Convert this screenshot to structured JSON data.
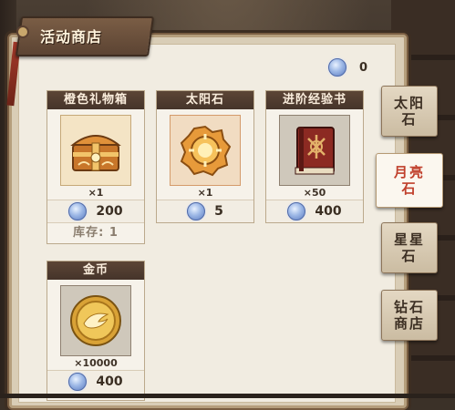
{
  "shop": {
    "title": "活动商店"
  },
  "currency": {
    "icon": "moon-stone-icon",
    "amount": "0"
  },
  "items": [
    {
      "name": "橙色礼物箱",
      "icon": "orange-gift-box-icon",
      "qty": "×1",
      "price": "200",
      "stock": "库存: 1"
    },
    {
      "name": "太阳石",
      "icon": "sun-stone-icon",
      "qty": "×1",
      "price": "5"
    },
    {
      "name": "进阶经验书",
      "icon": "exp-book-icon",
      "qty": "×50",
      "price": "400"
    },
    {
      "name": "金币",
      "icon": "gold-coin-icon",
      "qty": "×10000",
      "price": "400"
    }
  ],
  "tabs": [
    {
      "label": "太阳石",
      "active": false
    },
    {
      "label": "月亮石",
      "active": true
    },
    {
      "label": "星星石",
      "active": false
    },
    {
      "label": "钻石商店",
      "active": false
    }
  ],
  "colors": {
    "accent": "#c0402c",
    "header": "#45342a",
    "paper": "#f1ece1"
  }
}
